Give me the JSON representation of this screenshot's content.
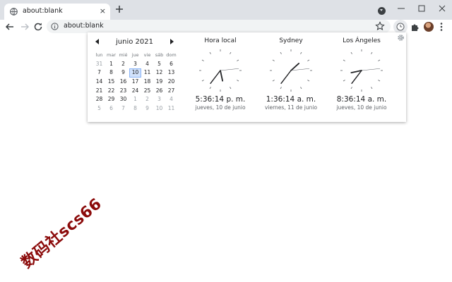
{
  "tab": {
    "title": "about:blank",
    "close": "×"
  },
  "omnibox": {
    "url": "about:blank"
  },
  "calendar": {
    "month_label": "junio 2021",
    "weekdays": [
      "lun",
      "mar",
      "mié",
      "jue",
      "vie",
      "sáb",
      "dom"
    ],
    "weeks": [
      [
        {
          "d": "31",
          "m": true
        },
        {
          "d": "1"
        },
        {
          "d": "2"
        },
        {
          "d": "3"
        },
        {
          "d": "4"
        },
        {
          "d": "5"
        },
        {
          "d": "6"
        }
      ],
      [
        {
          "d": "7"
        },
        {
          "d": "8"
        },
        {
          "d": "9"
        },
        {
          "d": "10",
          "today": true
        },
        {
          "d": "11"
        },
        {
          "d": "12"
        },
        {
          "d": "13"
        }
      ],
      [
        {
          "d": "14"
        },
        {
          "d": "15"
        },
        {
          "d": "16"
        },
        {
          "d": "17"
        },
        {
          "d": "18"
        },
        {
          "d": "19"
        },
        {
          "d": "20"
        }
      ],
      [
        {
          "d": "21"
        },
        {
          "d": "22"
        },
        {
          "d": "23"
        },
        {
          "d": "24"
        },
        {
          "d": "25"
        },
        {
          "d": "26"
        },
        {
          "d": "27"
        }
      ],
      [
        {
          "d": "28"
        },
        {
          "d": "29"
        },
        {
          "d": "30"
        },
        {
          "d": "1",
          "m": true
        },
        {
          "d": "2",
          "m": true
        },
        {
          "d": "3",
          "m": true
        },
        {
          "d": "4",
          "m": true
        }
      ],
      [
        {
          "d": "5",
          "m": true
        },
        {
          "d": "6",
          "m": true
        },
        {
          "d": "7",
          "m": true
        },
        {
          "d": "8",
          "m": true
        },
        {
          "d": "9",
          "m": true
        },
        {
          "d": "10",
          "m": true
        },
        {
          "d": "11",
          "m": true
        }
      ]
    ]
  },
  "clocks": [
    {
      "city": "Hora local",
      "time": "5:36:14 p. m.",
      "date": "jueves, 10 de junio",
      "h": 17,
      "m": 36,
      "s": 14
    },
    {
      "city": "Sydney",
      "time": "1:36:14 a. m.",
      "date": "viernes, 11 de junio",
      "h": 1,
      "m": 36,
      "s": 14
    },
    {
      "city": "Los Ángeles",
      "time": "8:36:14 a. m.",
      "date": "jueves, 10 de junio",
      "h": 8,
      "m": 36,
      "s": 14
    }
  ],
  "watermark": "数码社scs66",
  "icons": {
    "favicon": "globe-icon",
    "new_tab": "plus-icon",
    "tab_search": "tab-search-icon",
    "back": "back-arrow-icon",
    "forward": "forward-arrow-icon",
    "reload": "reload-icon",
    "info": "info-icon",
    "star": "star-icon",
    "clock_ext": "clock-extension-icon",
    "extensions": "puzzle-icon",
    "menu": "kebab-menu-icon",
    "gear": "gear-icon"
  }
}
